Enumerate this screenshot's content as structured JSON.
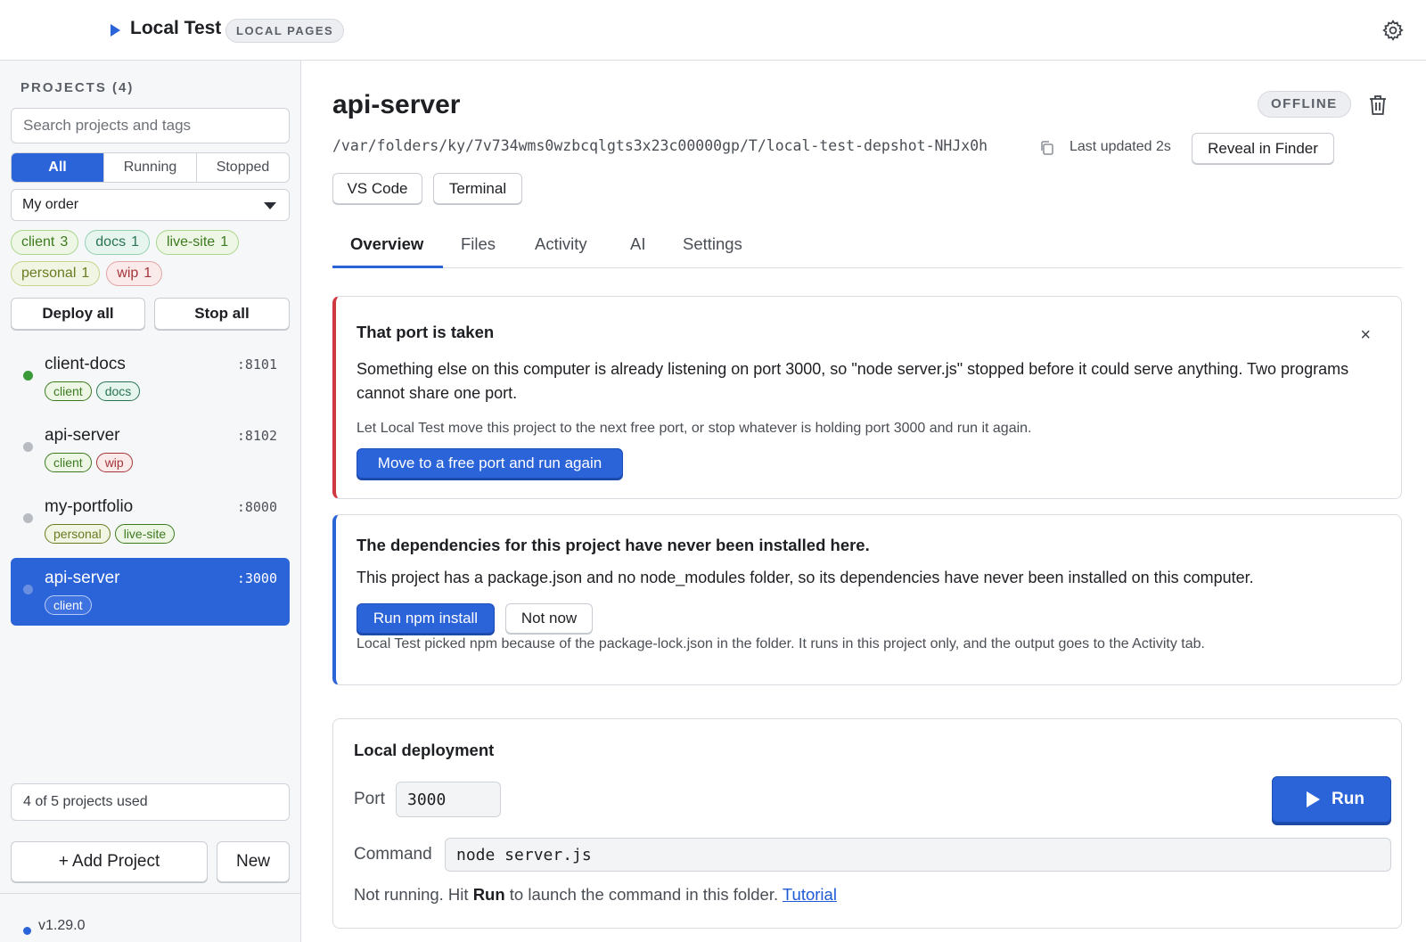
{
  "header": {
    "app_title": "Local Test",
    "badge": "LOCAL PAGES",
    "settings_icon": "gear-icon"
  },
  "sidebar": {
    "projects_heading": "PROJECTS (4)",
    "search_placeholder": "Search projects and tags",
    "filters": [
      "All",
      "Running",
      "Stopped"
    ],
    "active_filter": "All",
    "order_value": "My order",
    "tags": [
      {
        "name": "client",
        "count": "3",
        "color": "#3c7a1e"
      },
      {
        "name": "docs",
        "count": "1",
        "color": "#287452"
      },
      {
        "name": "live-site",
        "count": "1",
        "color": "#3c7a1e"
      },
      {
        "name": "personal",
        "count": "1",
        "color": "#6b7a20"
      },
      {
        "name": "wip",
        "count": "1",
        "color": "#a4353a"
      }
    ],
    "deploy_all": "Deploy all",
    "stop_all": "Stop all",
    "projects": [
      {
        "name": "client-docs",
        "port": ":8101",
        "status": "running",
        "tags": [
          "client",
          "docs"
        ]
      },
      {
        "name": "api-server",
        "port": ":8102",
        "status": "stopped",
        "tags": [
          "client",
          "wip"
        ]
      },
      {
        "name": "my-portfolio",
        "port": ":8000",
        "status": "stopped",
        "tags": [
          "personal",
          "live-site"
        ]
      },
      {
        "name": "api-server",
        "port": ":3000",
        "status": "stopped",
        "tags": [
          "client"
        ],
        "selected": true
      }
    ],
    "usage": "4 of 5 projects used",
    "add_project": "+ Add Project",
    "new": "New",
    "version": "v1.29.0"
  },
  "main": {
    "title": "api-server",
    "status_badge": "OFFLINE",
    "path": "/var/folders/ky/7v734wms0wzbcqlgts3x23c00000gp/T/local-test-depshot-NHJx0h",
    "last_updated": "Last updated 2s",
    "reveal": "Reveal in Finder",
    "open_vscode": "VS Code",
    "open_terminal": "Terminal",
    "tabs": [
      "Overview",
      "Files",
      "Activity",
      "AI",
      "Settings"
    ],
    "active_tab": "Overview",
    "port_error": {
      "title": "That port is taken",
      "body": "Something else on this computer is already listening on port 3000, so \"node server.js\" stopped before it could serve anything. Two programs cannot share one port.",
      "hint": "Let Local Test move this project to the next free port, or stop whatever is holding port 3000 and run it again.",
      "action": "Move to a free port and run again",
      "close": "×"
    },
    "deps": {
      "title": "The dependencies for this project have never been installed here.",
      "body": "This project has a package.json and no node_modules folder, so its dependencies have never been installed on this computer.",
      "install": "Run npm install",
      "dismiss": "Not now",
      "hint": "Local Test picked npm because of the package-lock.json in the folder. It runs in this project only, and the output goes to the Activity tab."
    },
    "deployment": {
      "title": "Local deployment",
      "port_label": "Port",
      "port_value": "3000",
      "command_label": "Command",
      "command_value": "node server.js",
      "run": "Run",
      "status_prefix": "Not running. Hit ",
      "status_bold": "Run",
      "status_suffix": " to launch the command in this folder.",
      "tutorial": "Tutorial"
    }
  },
  "colors": {
    "accent": "#2b63d8",
    "danger": "#d0393f",
    "running": "#3a9a3a"
  }
}
